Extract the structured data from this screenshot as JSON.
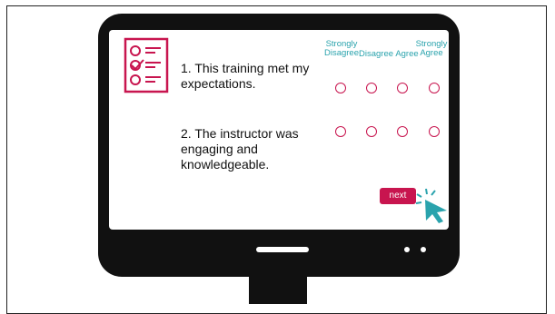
{
  "survey": {
    "questions": [
      {
        "number_text": "1. This training met my expectations."
      },
      {
        "number_text": "2. The instructor was engaging and knowledgeable."
      }
    ],
    "scale": {
      "strongly_disagree_line1": "Strongly",
      "strongly_disagree_line2": "Disagree",
      "disagree": "Disagree",
      "agree": "Agree",
      "strongly_agree_line1": "Strongly",
      "strongly_agree_line2": "Agree"
    },
    "next_label": "next"
  },
  "colors": {
    "accent": "#c8154f",
    "teal": "#2aa3ad",
    "bezel": "#111111"
  },
  "icons": [
    "checklist-icon",
    "cursor-click-icon"
  ]
}
